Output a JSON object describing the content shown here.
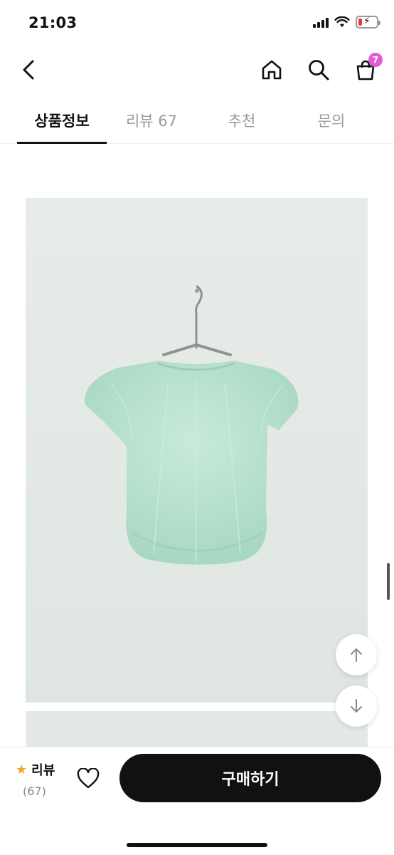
{
  "status_bar": {
    "time": "21:03",
    "icons": [
      "signal-icon",
      "wifi-icon",
      "battery-icon"
    ]
  },
  "nav": {
    "icons": [
      "back-arrow-icon",
      "home-icon",
      "search-icon",
      "shopping-bag-icon"
    ],
    "cart_badge": "7",
    "badge_color": "#e35ad6"
  },
  "tabs": [
    {
      "label": "상품정보",
      "active": true
    },
    {
      "label": "리뷰 67",
      "active": false
    },
    {
      "label": "추천",
      "active": false
    },
    {
      "label": "문의",
      "active": false
    }
  ],
  "product": {
    "garment_color": "#a9dcc4",
    "background_color": "#e6ebe8"
  },
  "floating_buttons": [
    "arrow-up-icon",
    "arrow-down-icon"
  ],
  "bottom_bar": {
    "review_label": "리뷰",
    "review_count": "(67)",
    "buy_label": "구매하기",
    "star_color": "#f5a623"
  }
}
